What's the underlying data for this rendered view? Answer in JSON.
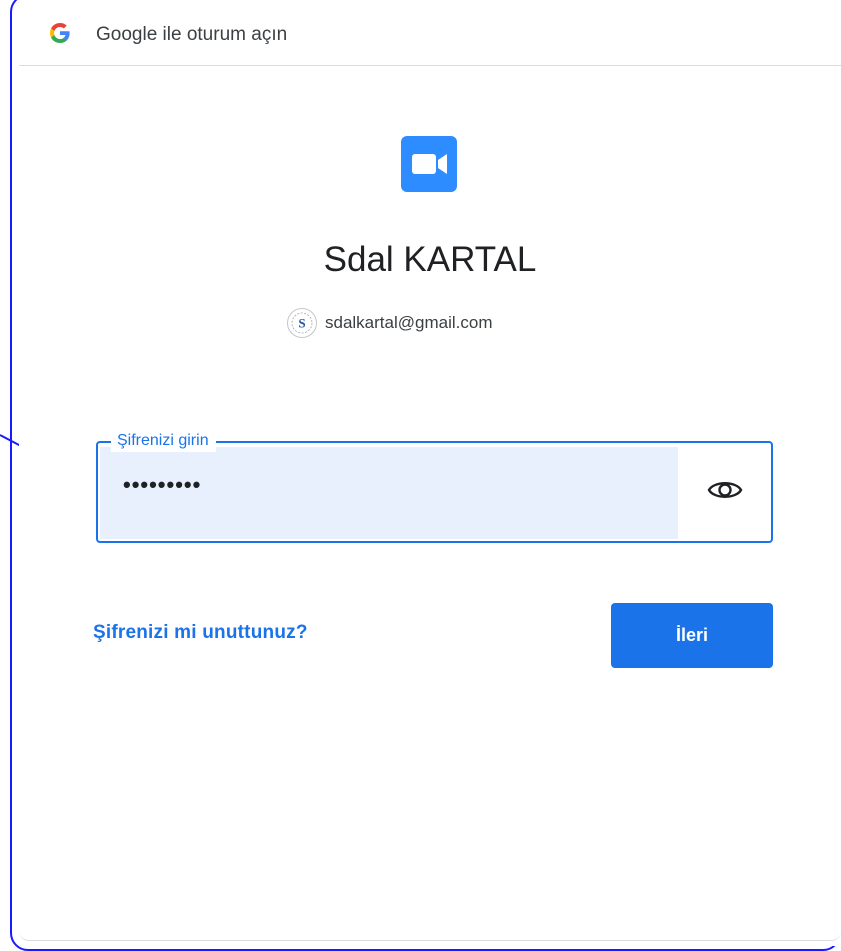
{
  "window": {
    "title": "Google ile oturum açın"
  },
  "icons": {
    "brand": "google-g-icon",
    "app": "zoom-video-camera-icon",
    "avatar": "letter-s-avatar-icon",
    "visibility": "eye-icon"
  },
  "account": {
    "name": "Sdal KARTAL",
    "email": "sdalkartal@gmail.com"
  },
  "password": {
    "label": "Şifrenizi girin",
    "value": "•••••••••"
  },
  "actions": {
    "forgot_label": "Şifrenizi mi unuttunuz?",
    "next_label": "İleri"
  },
  "colors": {
    "accent": "#1a73e8",
    "field_fill": "#e8f0fe",
    "annotation": "#1a1aff"
  }
}
